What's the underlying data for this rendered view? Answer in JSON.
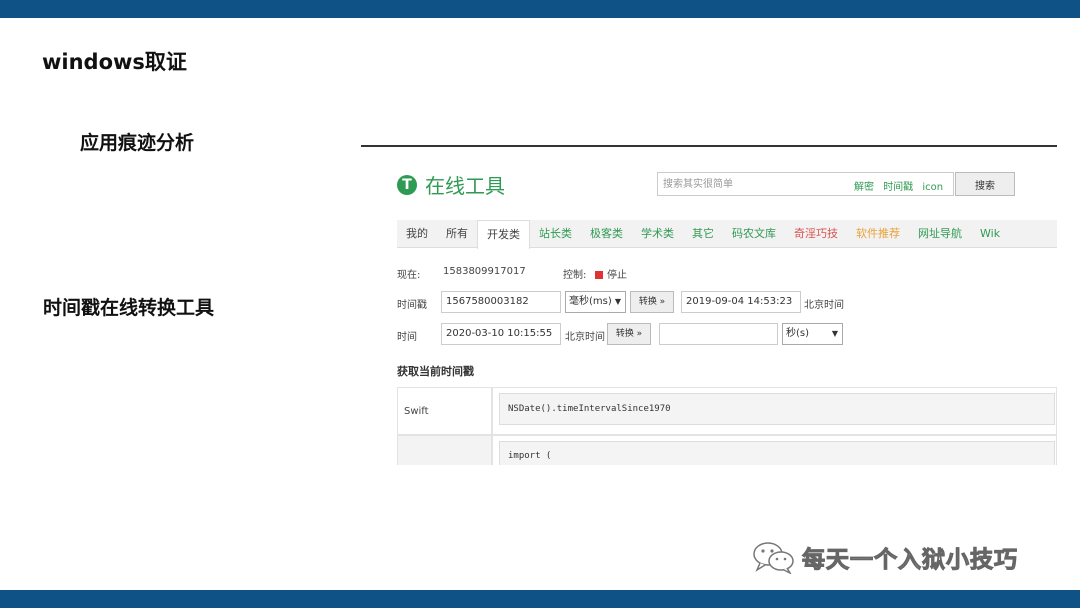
{
  "slide": {
    "title": "windows取证",
    "label_app_trace": "应用痕迹分析",
    "label_timestamp_tool": "时间戳在线转换工具",
    "watermark": "每天一个入狱小技巧",
    "colors": {
      "bar": "#0f5285",
      "brand_green": "#2f9a53",
      "stop_red": "#dd3333"
    }
  },
  "site": {
    "logo_letter": "T",
    "logo_text": "在线工具",
    "search": {
      "placeholder": "搜索其实很简单",
      "links": [
        "解密",
        "时间戳",
        "icon"
      ],
      "button": "搜索"
    },
    "tabs": [
      {
        "label": "我的",
        "color": "#444444"
      },
      {
        "label": "所有",
        "color": "#444444"
      },
      {
        "label": "开发类",
        "color": "#444444",
        "active": true
      },
      {
        "label": "站长类",
        "color": "#2f9a53"
      },
      {
        "label": "极客类",
        "color": "#2f9a53"
      },
      {
        "label": "学术类",
        "color": "#2f9a53"
      },
      {
        "label": "其它",
        "color": "#2f9a53"
      },
      {
        "label": "码农文库",
        "color": "#2f9a53"
      },
      {
        "label": "奇淫巧技",
        "color": "#d9534f"
      },
      {
        "label": "软件推荐",
        "color": "#e8a23a"
      },
      {
        "label": "网址导航",
        "color": "#2f9a53"
      },
      {
        "label": "Wik",
        "color": "#2f9a53"
      }
    ],
    "now": {
      "label": "现在:",
      "value": "1583809917017",
      "control_label": "控制:",
      "stop_label": "停止"
    },
    "ts_row": {
      "label": "时间戳",
      "input": "1567580003182",
      "unit": "毫秒(ms)",
      "button": "转换 »",
      "output": "2019-09-04 14:53:23",
      "tz": "北京时间"
    },
    "time_row": {
      "label": "时间",
      "input": "2020-03-10 10:15:55",
      "tz": "北京时间",
      "button": "转换 »",
      "output": "",
      "unit": "秒(s)"
    },
    "section_title": "获取当前时间戳",
    "code_rows": [
      {
        "lang": "Swift",
        "code": "NSDate().timeIntervalSince1970"
      },
      {
        "lang": "",
        "code": "import ("
      }
    ]
  }
}
